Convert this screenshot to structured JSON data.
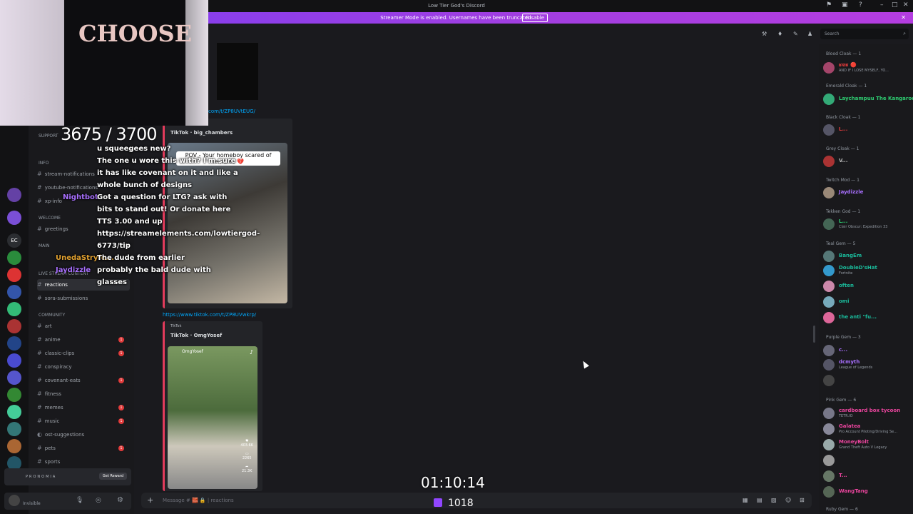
{
  "window": {
    "title": "Low Tier God's Discord"
  },
  "banner": {
    "text": "Streamer Mode is enabled. Usernames have been truncated.",
    "disable_label": "Disable"
  },
  "search": {
    "placeholder": "Search"
  },
  "channels": {
    "categories": {
      "support": "SUPPORT",
      "info": "INFO",
      "welcome": "WELCOME",
      "main": "MAIN",
      "live": "LIVE STREAM CONTENT",
      "community": "COMMUNITY"
    },
    "items": [
      {
        "label": "stream-notifications"
      },
      {
        "label": "youtube-notifications"
      },
      {
        "label": "xp-info"
      },
      {
        "label": "greetings"
      },
      {
        "label": "reactions"
      },
      {
        "label": "sora-submissions"
      },
      {
        "label": "art"
      },
      {
        "label": "anime"
      },
      {
        "label": "classic-clips"
      },
      {
        "label": "conspiracy"
      },
      {
        "label": "covenant-eats"
      },
      {
        "label": "fitness"
      },
      {
        "label": "memes"
      },
      {
        "label": "music"
      },
      {
        "label": "ost-suggestions"
      },
      {
        "label": "pets"
      },
      {
        "label": "sports"
      }
    ]
  },
  "extension": {
    "label": "PRONOMIA",
    "button": "Get Reward"
  },
  "user": {
    "status": "Invisible"
  },
  "messages": {
    "link1": "com/t/ZP8UVtEUG/",
    "embed1": {
      "provider": "TikTok",
      "author": "TikTok · big_chambers",
      "caption": "POV - Your homeboy scared of females 💔"
    },
    "link2": "https://www.tiktok.com/t/ZP8UVwkrp/",
    "embed2": {
      "provider": "TikTok",
      "author": "TikTok · OmgYosef",
      "uploader": "OmgYosef",
      "likes": "403.6K",
      "comments": "2265",
      "shares": "21.3K"
    }
  },
  "chatbox": {
    "placeholder": "Message # 🧱 🔒 | reactions"
  },
  "members": {
    "groups": [
      {
        "role": "Blood Cloak — 1",
        "members": [
          {
            "name": "ʁɐʁ 🔴",
            "sub": "AND IF I LOSE MYSELF, YO..."
          }
        ]
      },
      {
        "role": "Emerald Cloak — 1",
        "members": [
          {
            "name": "Laychampuu The Kangaroo",
            "sub": ""
          }
        ]
      },
      {
        "role": "Black Cloak — 1",
        "members": [
          {
            "name": "L...",
            "sub": ""
          }
        ]
      },
      {
        "role": "Grey Cloak — 1",
        "members": [
          {
            "name": "V...",
            "sub": ""
          }
        ]
      },
      {
        "role": "Twitch Mod — 1",
        "members": [
          {
            "name": "Jaydizzle",
            "sub": ""
          }
        ]
      },
      {
        "role": "Tekken God — 1",
        "members": [
          {
            "name": "L...",
            "sub": "Clair Obscur: Expedition 33"
          }
        ]
      },
      {
        "role": "Teal Gem — 5",
        "members": [
          {
            "name": "BangEm",
            "sub": ""
          },
          {
            "name": "DoubleD'sHat",
            "sub": "Fortnite"
          },
          {
            "name": "often",
            "sub": ""
          },
          {
            "name": "omi",
            "sub": ""
          },
          {
            "name": "the anti \"fu...",
            "sub": ""
          }
        ]
      },
      {
        "role": "Purple Gem — 3",
        "members": [
          {
            "name": "c...",
            "sub": ""
          },
          {
            "name": "dcmyth",
            "sub": "League of Legends"
          },
          {
            "name": "",
            "sub": ""
          }
        ]
      },
      {
        "role": "Pink Gem — 6",
        "members": [
          {
            "name": "cardboard box tycoon",
            "sub": "TETR.IO"
          },
          {
            "name": "Galatea",
            "sub": "Pro Account Piloting/Driving Se..."
          },
          {
            "name": "MoneyBolt",
            "sub": "Grand Theft Auto V Legacy"
          },
          {
            "name": "",
            "sub": ""
          },
          {
            "name": "T...",
            "sub": ""
          },
          {
            "name": "WangTang",
            "sub": ""
          }
        ]
      },
      {
        "role": "Ruby Gem — 6",
        "members": []
      }
    ]
  },
  "overlay": {
    "sub_counter": "3675 / 3700",
    "chat": [
      {
        "user": "",
        "text": "u squeegees new?"
      },
      {
        "user": "",
        "text": "The one u wore this with? I'm sure it has like covenant on it and like a whole bunch of designs"
      },
      {
        "user": "Nightbot",
        "text": "Got a question for LTG? ask with bits to stand out! Or donate here TTS 3.00 and up https://streamelements.com/lowtiergod-6773/tip"
      },
      {
        "user": "UnedaStryfe...",
        "text": "The dude from earlier"
      },
      {
        "user": "Jaydizzle",
        "text": "probably the bald dude with glasses"
      }
    ],
    "timer": "01:10:14",
    "viewers": "1018"
  },
  "colors": {
    "banner": "#a33ee0",
    "accent": "#5865f2",
    "link": "#00a8fc",
    "embed_border": "#e23b5b",
    "twitch": "#9146ff"
  }
}
